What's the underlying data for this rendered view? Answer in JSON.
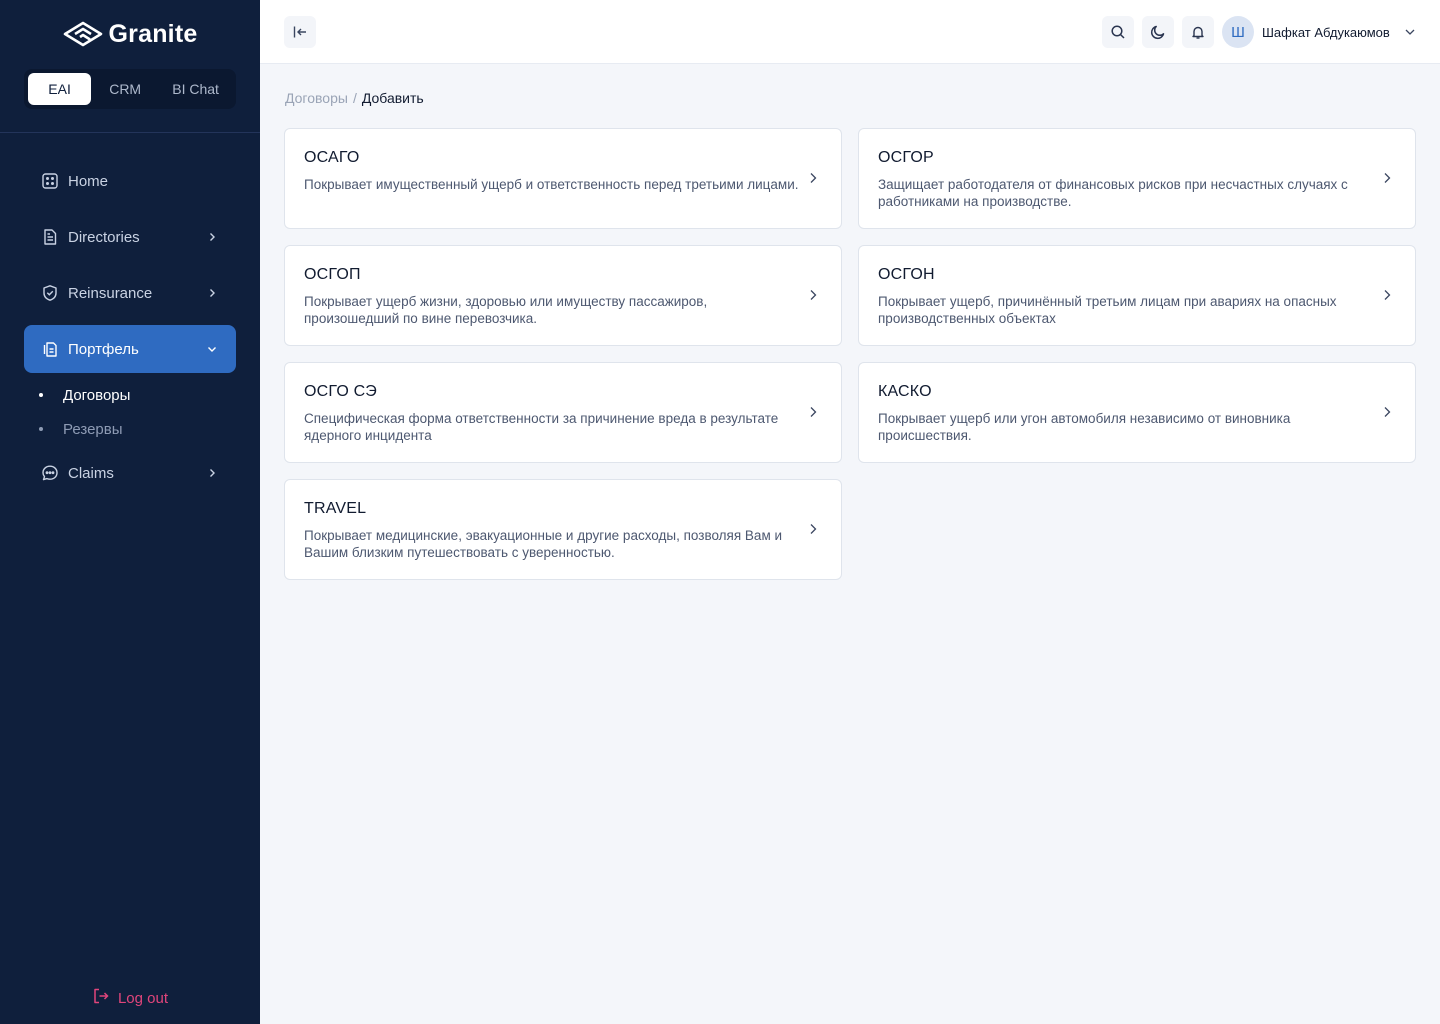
{
  "brand": {
    "name": "Granite"
  },
  "app_switcher": [
    {
      "label": "EAI",
      "active": true
    },
    {
      "label": "CRM",
      "active": false
    },
    {
      "label": "BI Chat",
      "active": false
    }
  ],
  "nav": {
    "home": "Home",
    "directories": "Directories",
    "reinsurance": "Reinsurance",
    "portfolio": "Портфель",
    "portfolio_sub": [
      "Договоры",
      "Резервы"
    ],
    "claims": "Claims"
  },
  "logout": "Log out",
  "user": {
    "initial": "Ш",
    "name": "Шафкат Абдукаюмов"
  },
  "breadcrumb": {
    "parent": "Договоры",
    "separator": "/",
    "current": "Добавить"
  },
  "products": [
    {
      "title": "ОСАГО",
      "desc": "Покрывает имущественный ущерб и ответственность перед третьими лицами."
    },
    {
      "title": "ОСГОР",
      "desc": "Защищает работодателя от финансовых рисков при несчастных случаях с работниками на производстве."
    },
    {
      "title": "ОСГОП",
      "desc": "Покрывает ущерб жизни, здоровью или имуществу пассажиров, произошедший по вине перевозчика."
    },
    {
      "title": "ОСГОН",
      "desc": "Покрывает ущерб, причинённый третьим лицам при авариях на опасных производственных объектах"
    },
    {
      "title": "ОСГО СЭ",
      "desc": "Специфическая форма ответственности за причинение вреда в результате ядерного инцидента"
    },
    {
      "title": "КАСКО",
      "desc": "Покрывает ущерб или угон автомобиля независимо от виновника происшествия."
    },
    {
      "title": "TRAVEL",
      "desc": "Покрывает медицинские, эвакуационные и другие расходы, позволяя Вам и Вашим близким путешествовать с уверенностью."
    }
  ],
  "colors": {
    "sidebar_bg": "#0f1f3c",
    "accent": "#2f6bc1",
    "logout": "#e0457b",
    "page_bg": "#f4f6fa"
  }
}
